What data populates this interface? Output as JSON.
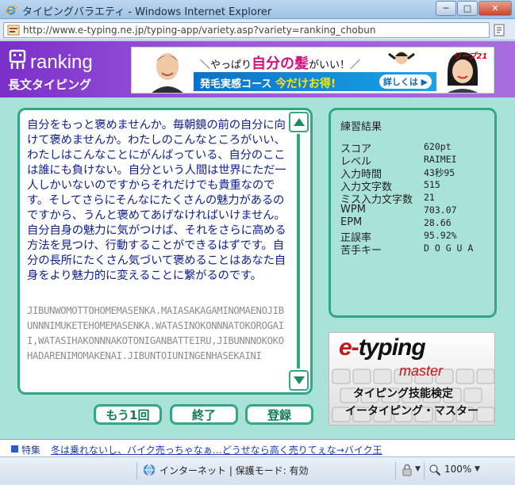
{
  "window": {
    "title": "タイピングバラエティ - Windows Internet Explorer",
    "minimize": "─",
    "maximize": "□",
    "close": "✕"
  },
  "address": {
    "url": "http://www.e-typing.ne.jp/typing-app/variety.asp?variety=ranking_chobun"
  },
  "header": {
    "title": "ranking",
    "subtitle": "長文タイピング"
  },
  "banner": {
    "catch_pre": "＼やっぱり",
    "catch_hl": "自分の髪",
    "catch_post": "がいい！／",
    "strip_pre": "発毛実感コース ",
    "strip_hl": "今だけお得!",
    "detail": "詳しくは ▶",
    "brand": "リーブ21"
  },
  "text_panel": {
    "japanese": "自分をもっと褒めませんか。毎朝鏡の前の自分に向けて褒めませんか。わたしのこんなところがいい、わたしはこんなことにがんばっている、自分のここは誰にも負けない。自分という人間は世界にただ一人しかいないのですからそれだけでも貴重なのです。そしてさらにそんなにたくさんの魅力があるのですから、うんと褒めてあげなければいけません。自分自身の魅力に気がつけば、それをさらに高める方法を見つけ、行動することができるはずです。自分の長所にたくさん気づいて褒めることはあなた自身をより魅力的に変えることに繋がるのです。",
    "romaji": "JIBUNWOMOTTOHOMEMASENKA.MAIASAKAGAMINOMAENOJIBUNNNIMUKETEHOMEMASENKA.WATASINOKONNNATOKOROGAII,WATASIHAKONNNAKOTONIGANBATTEIRU,JIBUNNNOKOKOHADARENIMOMAKENAI.JIBUNTOIUNINGENHASEKAINI"
  },
  "buttons": {
    "retry": "もう1回",
    "finish": "終了",
    "register": "登録"
  },
  "results": {
    "title": "練習結果",
    "rows": [
      {
        "label": "スコア",
        "value": "620pt"
      },
      {
        "label": "レベル",
        "value": "RAIMEI"
      },
      {
        "label": "入力時間",
        "value": "43秒95"
      },
      {
        "label": "入力文字数",
        "value": "515"
      },
      {
        "label": "ミス入力文字数",
        "value": "21"
      },
      {
        "label": "WPM",
        "value": "703.07"
      },
      {
        "label": "EPM",
        "value": "28.66"
      },
      {
        "label": "正誤率",
        "value": "95.92%"
      },
      {
        "label": "苦手キー",
        "value": "D O G U A"
      }
    ]
  },
  "etm_ad": {
    "line1_a": "e-",
    "line1_b": "typing",
    "line2": "master",
    "line3": "タイピング技能検定",
    "line4": "イータイピング・マスター"
  },
  "footer": {
    "feature": "特集",
    "link": "冬は乗れないし、バイク売っちゃなぁ…どうせなら高く売りてぇな→バイク王"
  },
  "status": {
    "zone": "インターネット | 保護モード: 有効",
    "zoom": "100%"
  },
  "colors": {
    "header_purple": "#8b42d0",
    "panel_green": "#34a882",
    "panel_bg": "#a9e2d8",
    "text_blue": "#0e1f8f"
  }
}
